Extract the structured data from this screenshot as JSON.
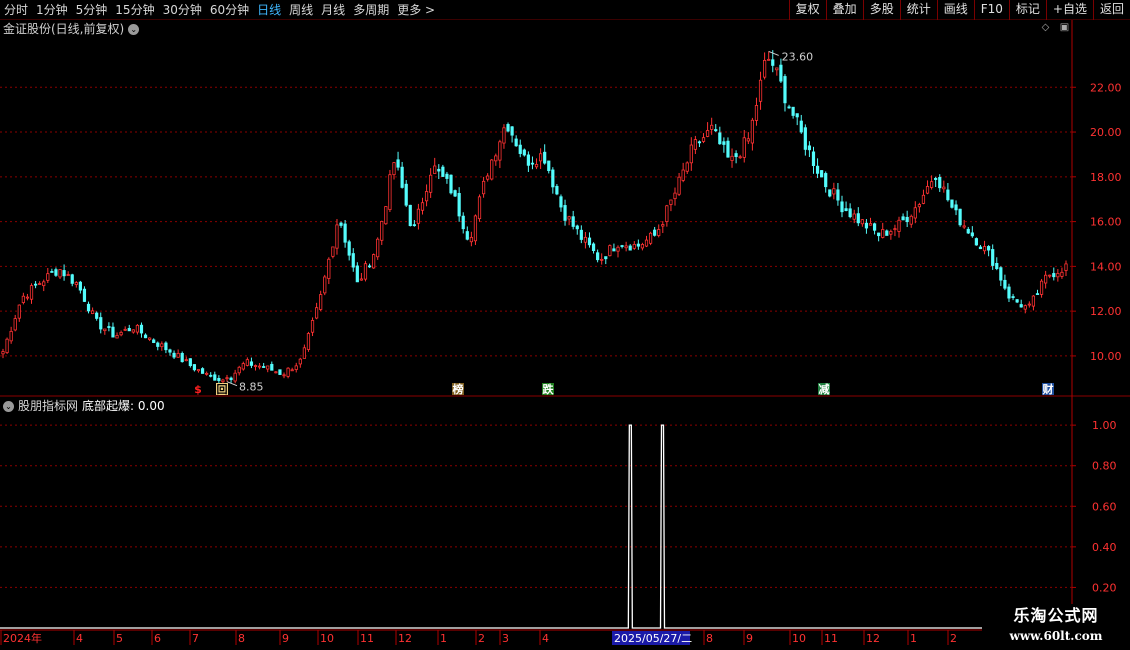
{
  "toolbar": {
    "periods": [
      {
        "label": "分时",
        "active": false
      },
      {
        "label": "1分钟",
        "active": false
      },
      {
        "label": "5分钟",
        "active": false
      },
      {
        "label": "15分钟",
        "active": false
      },
      {
        "label": "30分钟",
        "active": false
      },
      {
        "label": "60分钟",
        "active": false
      },
      {
        "label": "日线",
        "active": true
      },
      {
        "label": "周线",
        "active": false
      },
      {
        "label": "月线",
        "active": false
      },
      {
        "label": "多周期",
        "active": false
      },
      {
        "label": "更多 >",
        "active": false
      }
    ],
    "buttons": [
      "复权",
      "叠加",
      "多股",
      "统计",
      "画线",
      "F10",
      "标记",
      "+自选",
      "返回"
    ]
  },
  "main_chart": {
    "title": "金证股份(日线,前复权)",
    "high_label": "23.60",
    "low_label": "8.85",
    "y_ticks": [
      "22.00",
      "20.00",
      "18.00",
      "16.00",
      "14.00",
      "12.00",
      "10.00"
    ],
    "markers": [
      {
        "text": "$",
        "color": "#ff2020",
        "bg": "none"
      },
      {
        "text": "回",
        "color": "#000000",
        "bg": "#f0d080"
      },
      {
        "text": "榜",
        "color": "#ffffff",
        "bg": "#806020"
      },
      {
        "text": "跌",
        "color": "#ffffff",
        "bg": "#208020"
      },
      {
        "text": "减",
        "color": "#ffffff",
        "bg": "#208040"
      },
      {
        "text": "财",
        "color": "#ffffff",
        "bg": "#2050a0"
      }
    ]
  },
  "indicator": {
    "name": "股朋指标网",
    "line_label": "底部起爆: 0.00",
    "y_ticks": [
      "1.00",
      "0.80",
      "0.60",
      "0.40",
      "0.20"
    ]
  },
  "x_axis": {
    "labels": [
      "2024年",
      "4",
      "5",
      "6",
      "7",
      "8",
      "9",
      "10",
      "11",
      "12",
      "1",
      "2",
      "3",
      "4",
      "6",
      "7",
      "8",
      "9",
      "10",
      "11",
      "12",
      "1",
      "2"
    ],
    "cursor_label": "2025/05/27/二"
  },
  "watermark": {
    "title": "乐淘公式网",
    "url": "www.60lt.com"
  },
  "colors": {
    "up": "#ff3232",
    "down": "#54fcfc",
    "grid": "#8b0000",
    "axis_text": "#ff3232",
    "cursor_bg": "#1a1aa8"
  },
  "chart_data": [
    {
      "type": "candlestick",
      "title": "金证股份(日线,前复权)",
      "ylim": [
        8.3,
        24.2
      ],
      "y_ticks": [
        22,
        20,
        18,
        16,
        14,
        12,
        10
      ],
      "x": [
        "2024-03",
        "2024-04",
        "2024-05",
        "2024-06",
        "2024-07",
        "2024-08",
        "2024-09",
        "2024-10",
        "2024-11",
        "2024-12",
        "2025-01",
        "2025-02",
        "2025-03",
        "2025-04",
        "2025-05",
        "2025-06",
        "2025-07",
        "2025-08",
        "2025-09",
        "2025-10",
        "2025-11",
        "2025-12",
        "2026-01",
        "2026-02"
      ],
      "close_path": [
        10.2,
        12.6,
        13.3,
        13.9,
        13.2,
        11.5,
        10.9,
        11.3,
        10.7,
        10.2,
        9.6,
        9.1,
        8.9,
        9.7,
        9.5,
        9.2,
        9.8,
        12.5,
        16.3,
        13.2,
        14.8,
        18.8,
        15.5,
        18.5,
        17.5,
        15.2,
        18.3,
        20.5,
        18.7,
        19.0,
        16.5,
        15.3,
        14.3,
        15.1,
        14.9,
        15.4,
        17.2,
        19.3,
        20.1,
        18.6,
        19.7,
        23.6,
        21.5,
        19.5,
        17.8,
        16.7,
        16.0,
        15.4,
        15.8,
        16.7,
        18.2,
        16.4,
        15.4,
        14.4,
        12.6,
        12.1,
        13.6,
        14.0
      ],
      "high": 23.6,
      "low": 8.85
    },
    {
      "type": "line",
      "name": "底部起爆",
      "ylim": [
        0,
        1.05
      ],
      "y_ticks": [
        1.0,
        0.8,
        0.6,
        0.4,
        0.2
      ],
      "pulses_at_fraction": [
        0.588,
        0.618
      ],
      "pulse_value": 1.0,
      "last_value": 0.0
    }
  ]
}
